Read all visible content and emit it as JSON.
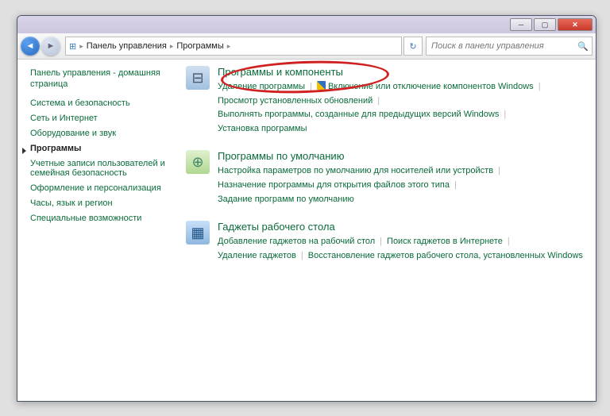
{
  "breadcrumbs": [
    "Панель управления",
    "Программы"
  ],
  "search": {
    "placeholder": "Поиск в панели управления"
  },
  "sidebar": {
    "home": "Панель управления - домашняя страница",
    "items": [
      {
        "label": "Система и безопасность"
      },
      {
        "label": "Сеть и Интернет"
      },
      {
        "label": "Оборудование и звук"
      },
      {
        "label": "Программы",
        "active": true
      },
      {
        "label": "Учетные записи пользователей и семейная безопасность"
      },
      {
        "label": "Оформление и персонализация"
      },
      {
        "label": "Часы, язык и регион"
      },
      {
        "label": "Специальные возможности"
      }
    ]
  },
  "sections": [
    {
      "title": "Программы и компоненты",
      "links": [
        {
          "t": "Удаление программы"
        },
        {
          "t": "Включение или отключение компонентов Windows",
          "shield": true
        },
        {
          "t": "Просмотр установленных обновлений"
        },
        {
          "t": "Выполнять программы, созданные для предыдущих версий Windows"
        },
        {
          "t": "Установка программы"
        }
      ]
    },
    {
      "title": "Программы по умолчанию",
      "links": [
        {
          "t": "Настройка параметров по умолчанию для носителей или устройств"
        },
        {
          "t": "Назначение программы для открытия файлов этого типа"
        },
        {
          "t": "Задание программ по умолчанию"
        }
      ]
    },
    {
      "title": "Гаджеты рабочего стола",
      "links": [
        {
          "t": "Добавление гаджетов на рабочий стол"
        },
        {
          "t": "Поиск гаджетов в Интернете"
        },
        {
          "t": "Удаление гаджетов"
        },
        {
          "t": "Восстановление гаджетов рабочего стола, установленных Windows"
        }
      ]
    }
  ]
}
